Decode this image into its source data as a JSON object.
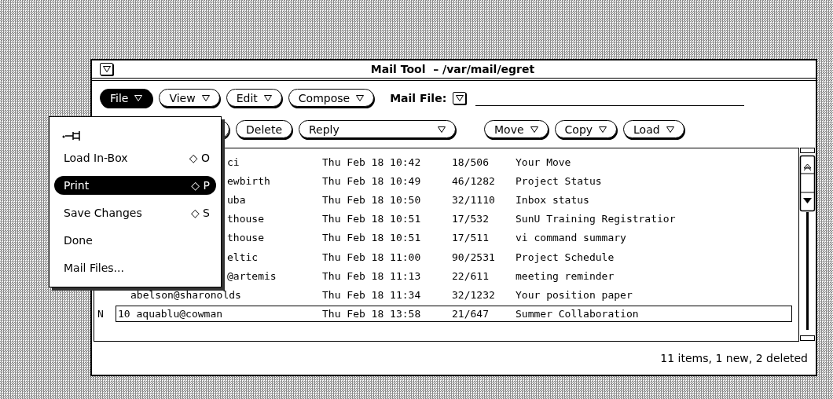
{
  "window": {
    "title": "Mail Tool  – /var/mail/egret"
  },
  "controls": [
    {
      "label": "File",
      "menu": true,
      "selected": true
    },
    {
      "label": "View",
      "menu": true,
      "selected": false
    },
    {
      "label": "Edit",
      "menu": true,
      "selected": false
    },
    {
      "label": "Compose",
      "menu": true,
      "selected": false
    }
  ],
  "mail_file": {
    "label": "Mail File:"
  },
  "controls_row2": [
    {
      "label": "Delete",
      "menu": false,
      "wide": false
    },
    {
      "label": "Reply",
      "menu": true,
      "wide": true
    },
    {
      "label": "Move",
      "menu": true,
      "wide": false
    },
    {
      "label": "Copy",
      "menu": true,
      "wide": false
    },
    {
      "label": "Load",
      "menu": true,
      "wide": false
    }
  ],
  "messages": [
    {
      "kind": "partial",
      "sender": "ci",
      "date": "Thu Feb 18 10:42",
      "size": "18/506",
      "subject": "Your Move",
      "selected": false
    },
    {
      "kind": "partial",
      "sender": "ewbirth",
      "date": "Thu Feb 18 10:49",
      "size": "46/1282",
      "subject": "Project Status",
      "selected": false
    },
    {
      "kind": "partial",
      "sender": "uba",
      "date": "Thu Feb 18 10:50",
      "size": "32/1110",
      "subject": "Inbox status",
      "selected": false
    },
    {
      "kind": "partial",
      "sender": "thouse",
      "date": "Thu Feb 18 10:51",
      "size": "17/532",
      "subject": "SunU Training Registratior",
      "selected": false
    },
    {
      "kind": "partial",
      "sender": "thouse",
      "date": "Thu Feb 18 10:51",
      "size": "17/511",
      "subject": "vi command summary",
      "selected": false
    },
    {
      "kind": "partial",
      "sender": "eltic",
      "date": "Thu Feb 18 11:00",
      "size": "90/2531",
      "subject": "Project Schedule",
      "selected": false
    },
    {
      "kind": "partial",
      "sender": "@artemis",
      "date": "Thu Feb 18 11:13",
      "size": "22/611",
      "subject": "meeting reminder",
      "selected": false
    },
    {
      "kind": "number_hidden",
      "sender": "abelson@sharonolds",
      "date": "Thu Feb 18 11:34",
      "size": "32/1232",
      "subject": "Your position paper",
      "selected": false
    },
    {
      "kind": "full",
      "status": "N",
      "sender": "10 aquablu@cowman",
      "date": "Thu Feb 18 13:58",
      "size": "21/647",
      "subject": "Summer Collaboration",
      "selected": true
    }
  ],
  "status_bar": "11 items, 1 new, 2 deleted",
  "file_menu": {
    "items": [
      {
        "label": "Load In-Box",
        "shortcut": "◇ O",
        "selected": false
      },
      {
        "label": "Print",
        "shortcut": "◇ P",
        "selected": true
      },
      {
        "label": "Save Changes",
        "shortcut": "◇ S",
        "selected": false
      },
      {
        "label": "Done",
        "selected": false
      },
      {
        "label": "Mail Files...",
        "selected": false
      }
    ]
  }
}
